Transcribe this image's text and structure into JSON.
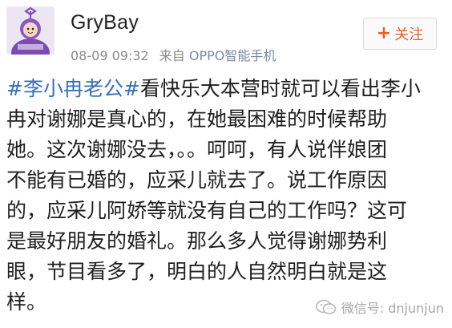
{
  "post": {
    "username": "GryBay",
    "time": "08-09 09:32",
    "source_prefix": "来自",
    "source_device": "OPPO智能手机",
    "follow_label": "关注",
    "follow_icon": "plus-icon",
    "topic": "#李小冉老公#",
    "lines": [
      "看快乐大本营时就可以看出李小",
      "冉对谢娜是真心的，在她最困难的时候帮助",
      "她。这次谢娜没去，。。呵呵，有人说伴娘团",
      "不能有已婚的，应采儿就去了。说工作原因",
      "的，应采儿阿娇等就没有自己的工作吗？这可",
      "是最好朋友的婚礼。那么多人觉得谢娜势利",
      "眼，节目看多了，明白的人自然明白就是这",
      "样。"
    ]
  },
  "watermark": {
    "icon": "wechat-icon",
    "text": "微信号: dnjunjun"
  },
  "colors": {
    "topic": "#3b6fb0",
    "follow": "#e8602c",
    "meta": "#8a8a8a"
  }
}
